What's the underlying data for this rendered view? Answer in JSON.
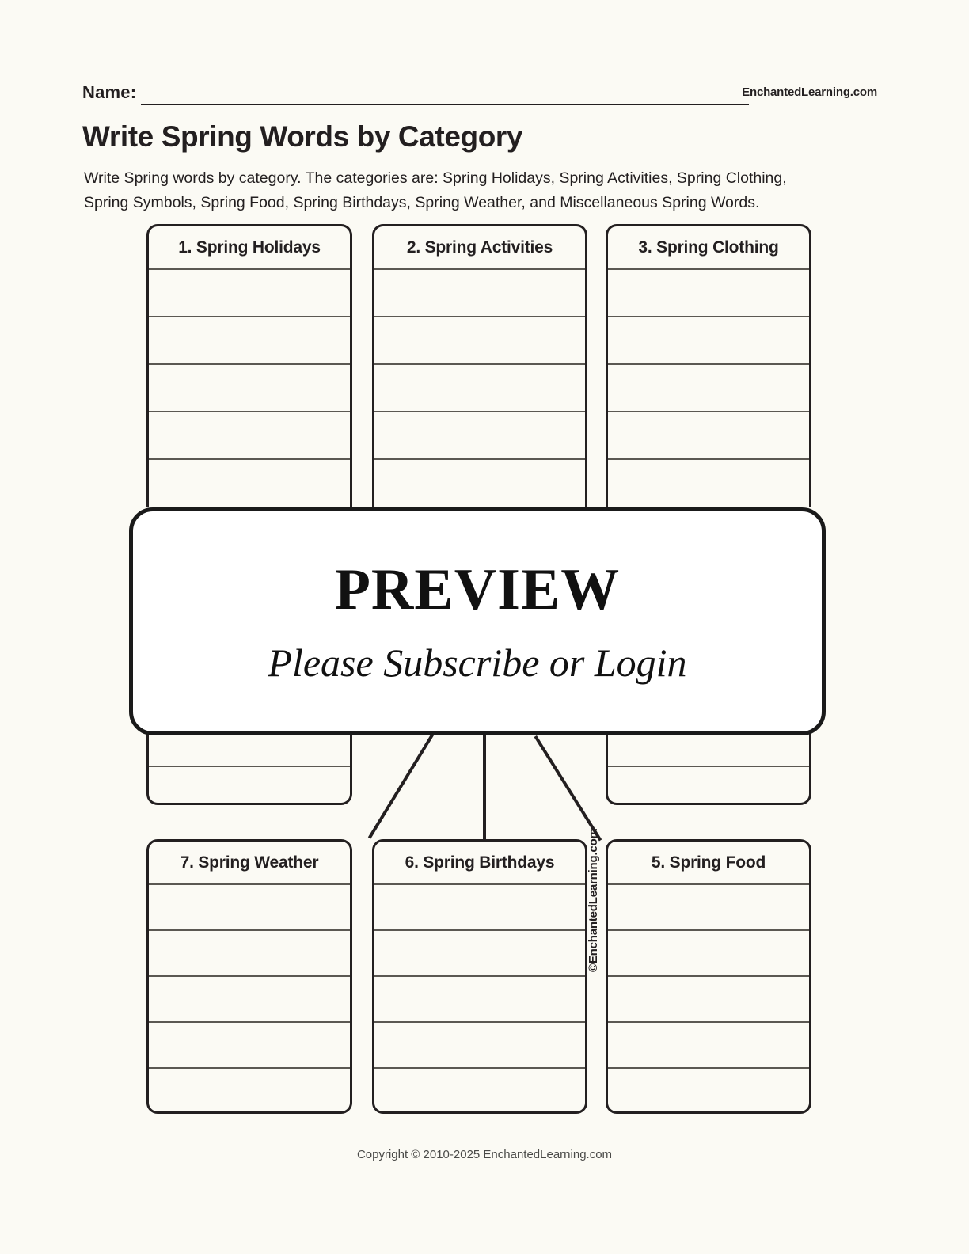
{
  "header": {
    "name_label": "Name:",
    "site_logo": "EnchantedLearning.com"
  },
  "title": "Write Spring Words by Category",
  "instructions": "Write Spring words by category. The categories are: Spring Holidays, Spring Activities, Spring Clothing, Spring Symbols, Spring Food, Spring Birthdays, Spring Weather, and Miscellaneous Spring Words.",
  "categories": {
    "top_row": [
      {
        "label": "1. Spring Holidays",
        "rows": 5
      },
      {
        "label": "2. Spring Activities",
        "rows": 5
      },
      {
        "label": "3. Spring Clothing",
        "rows": 5
      }
    ],
    "middle_row": [
      {
        "label": "",
        "rows": 2
      },
      {
        "label": "",
        "rows": 2
      }
    ],
    "bottom_row": [
      {
        "label": "7. Spring Weather",
        "rows": 5
      },
      {
        "label": "6. Spring Birthdays",
        "rows": 5
      },
      {
        "label": "5. Spring Food",
        "rows": 5
      }
    ]
  },
  "overlay": {
    "title": "PREVIEW",
    "subtitle": "Please Subscribe or Login"
  },
  "watermark": "©EnchantedLearning.com",
  "footer": "Copyright © 2010-2025 EnchantedLearning.com",
  "colors": {
    "page_background": "#fbfaf4",
    "ink": "#231f20",
    "rule": "#5b5852",
    "overlay_background": "#ffffff"
  }
}
